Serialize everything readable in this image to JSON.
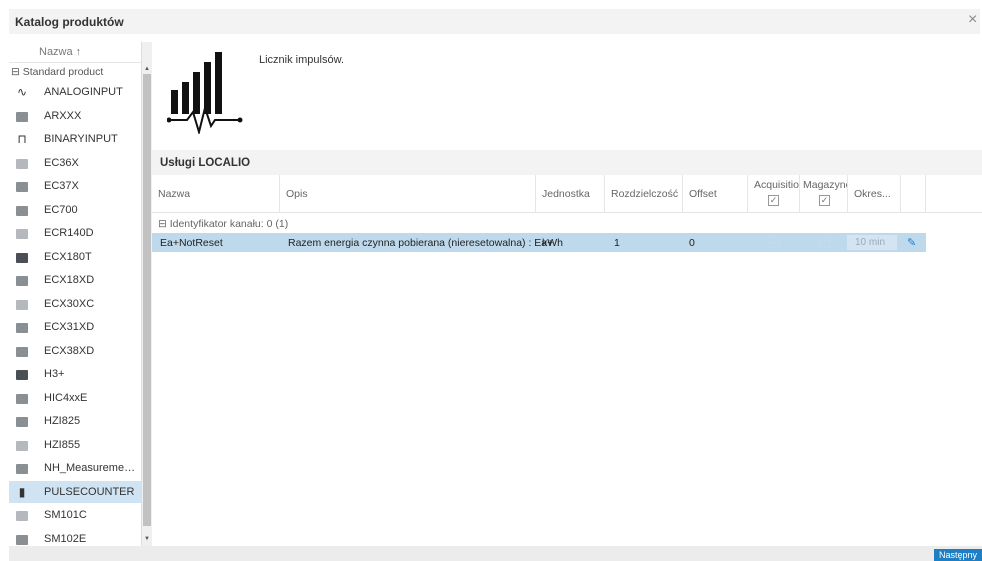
{
  "dialog": {
    "title": "Katalog produktów",
    "close_label": "×"
  },
  "list": {
    "column_header": "Nazwa ↑",
    "group_label": "⊟ Standard product",
    "items": [
      {
        "label": "ANALOGINPUT",
        "icon": "wave-icon"
      },
      {
        "label": "ARXXX",
        "icon": "device-icon"
      },
      {
        "label": "BINARYINPUT",
        "icon": "pulse-icon"
      },
      {
        "label": "EC36X",
        "icon": "device-icon"
      },
      {
        "label": "EC37X",
        "icon": "device-icon"
      },
      {
        "label": "EC700",
        "icon": "device-icon"
      },
      {
        "label": "ECR140D",
        "icon": "device-icon"
      },
      {
        "label": "ECX180T",
        "icon": "device-icon"
      },
      {
        "label": "ECX18XD",
        "icon": "device-icon"
      },
      {
        "label": "ECX30XC",
        "icon": "device-icon"
      },
      {
        "label": "ECX31XD",
        "icon": "device-icon"
      },
      {
        "label": "ECX38XD",
        "icon": "device-icon"
      },
      {
        "label": "H3+",
        "icon": "device-icon"
      },
      {
        "label": "HIC4xxE",
        "icon": "device-icon"
      },
      {
        "label": "HZI825",
        "icon": "device-icon"
      },
      {
        "label": "HZI855",
        "icon": "device-icon"
      },
      {
        "label": "NH_Measurement...",
        "icon": "device-icon"
      },
      {
        "label": "PULSECOUNTER",
        "icon": "bars-icon",
        "selected": true
      },
      {
        "label": "SM101C",
        "icon": "device-icon"
      },
      {
        "label": "SM102E",
        "icon": "device-icon"
      }
    ]
  },
  "detail": {
    "description": "Licznik impulsów."
  },
  "services": {
    "title": "Usługi LOCALIO",
    "columns": {
      "nazwa": "Nazwa",
      "opis": "Opis",
      "jednostka": "Jednostka",
      "rozdzielczosc": "Rozdzielczość",
      "offset": "Offset",
      "acquisition": "Acquisition",
      "magazynowanie": "Magazyno",
      "okres": "Okres..."
    },
    "group": "⊟ Identyfikator kanału: 0 (1)",
    "row": {
      "nazwa": "Ea+NotReset",
      "opis": "Razem energia czynna pobierana (nieresetowalna) : Ea+",
      "jednostka": "kWh",
      "rozdzielczosc": "1",
      "offset": "0",
      "okres": "10 min"
    }
  },
  "footer": {
    "next_label": "Następny"
  }
}
